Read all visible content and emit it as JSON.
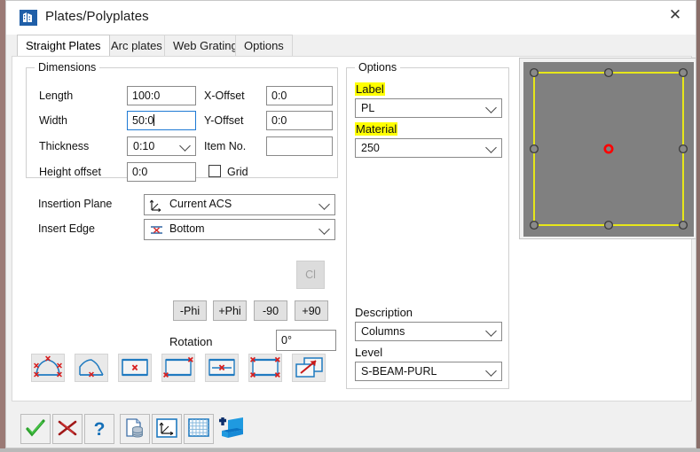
{
  "window": {
    "title": "Plates/Polyplates",
    "icon": "building-icon",
    "close_label": "✕"
  },
  "tabs": [
    {
      "label": "Straight Plates",
      "active": true,
      "name": "tab-straight-plates"
    },
    {
      "label": "Arc plates",
      "active": false,
      "name": "tab-arc-plates"
    },
    {
      "label": "Web Grating",
      "active": false,
      "name": "tab-web-grating"
    },
    {
      "label": "Options",
      "active": false,
      "name": "tab-options"
    }
  ],
  "dimensions": {
    "title": "Dimensions",
    "length_label": "Length",
    "length_value": "100:0",
    "width_label": "Width",
    "width_value": "50:0",
    "thickness_label": "Thickness",
    "thickness_value": "0:10",
    "height_offset_label": "Height offset",
    "height_offset_value": "0:0",
    "x_offset_label": "X-Offset",
    "x_offset_value": "0:0",
    "y_offset_label": "Y-Offset",
    "y_offset_value": "0:0",
    "item_no_label": "Item No.",
    "item_no_value": "",
    "grid_label": "Grid",
    "grid_checked": false
  },
  "placement": {
    "insertion_plane_label": "Insertion Plane",
    "insertion_plane_value": "Current ACS",
    "insertion_plane_icon": "acs-axis-icon",
    "insert_edge_label": "Insert Edge",
    "insert_edge_value": "Bottom",
    "insert_edge_icon": "edge-marker-icon"
  },
  "rotation": {
    "clear_label": "Cl",
    "clear_disabled": true,
    "minus_phi_label": "-Phi",
    "plus_phi_label": "+Phi",
    "minus_90_label": "-90",
    "plus_90_label": "+90",
    "rotation_label": "Rotation",
    "rotation_value": "0°"
  },
  "shape_buttons": [
    {
      "name": "shape-polyplate-arc-nodes-icon"
    },
    {
      "name": "shape-polyplate-bottom-node-icon"
    },
    {
      "name": "shape-plate-center-node-icon"
    },
    {
      "name": "shape-plate-corner-nodes-icon"
    },
    {
      "name": "shape-plate-midline-node-icon"
    },
    {
      "name": "shape-plate-all-corner-nodes-icon"
    },
    {
      "name": "shape-plate-move-copy-icon"
    }
  ],
  "options": {
    "title": "Options",
    "label_label": "Label",
    "label_value": "PL",
    "material_label": "Material",
    "material_value": "250",
    "description_label": "Description",
    "description_value": "Columns",
    "level_label": "Level",
    "level_value": "S-BEAM-PURL",
    "highlight_color": "#ffff00"
  },
  "preview": {
    "name": "plate-preview",
    "fill_color": "#808080",
    "outline_color": "#ffff00",
    "center_marker_color": "#ff0000",
    "handle_color": "#6e6e6e",
    "handles": 8
  },
  "toolbar": [
    {
      "name": "ok-button",
      "icon": "green-check-icon"
    },
    {
      "name": "cancel-button",
      "icon": "red-x-icon"
    },
    {
      "name": "help-button",
      "icon": "blue-question-icon"
    },
    {
      "name": "database-button",
      "icon": "document-database-icon"
    },
    {
      "name": "acs-button",
      "icon": "axis-frame-icon"
    },
    {
      "name": "grid-button",
      "icon": "grid-table-icon"
    },
    {
      "name": "plate-3d-button",
      "icon": "blue-plate-3d-icon"
    }
  ]
}
